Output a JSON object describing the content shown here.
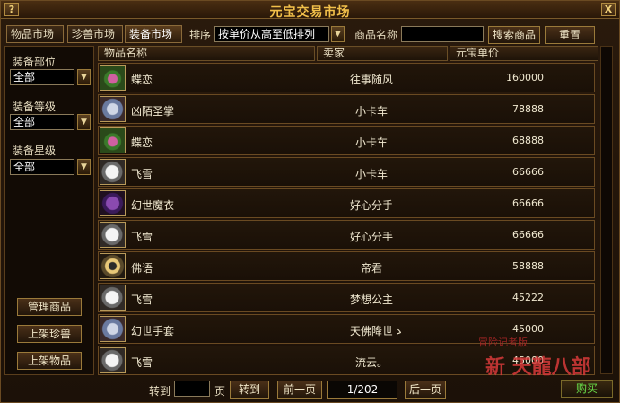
{
  "window": {
    "title": "元宝交易市场",
    "help_label": "?",
    "close_label": "X"
  },
  "tabs": [
    {
      "label": "物品市场"
    },
    {
      "label": "珍兽市场"
    },
    {
      "label": "装备市场"
    }
  ],
  "toolbar": {
    "sort_label": "排序",
    "sort_value": "按单价从高至低排列",
    "name_label": "商品名称",
    "search_button": "搜索商品",
    "reset_button": "重置"
  },
  "sidebar": {
    "slot_label": "装备部位",
    "slot_value": "全部",
    "level_label": "装备等级",
    "level_value": "全部",
    "star_label": "装备星级",
    "star_value": "全部",
    "manage_button": "管理商品",
    "list_pet_button": "上架珍兽",
    "list_item_button": "上架物品"
  },
  "columns": {
    "name": "物品名称",
    "seller": "卖家",
    "price": "元宝单价"
  },
  "rows": [
    {
      "icon": "gem-amulet-icon",
      "name": "蝶恋",
      "seller": "往事随风",
      "price": "160000"
    },
    {
      "icon": "gauntlet-icon",
      "name": "凶陌圣掌",
      "seller": "小卡车",
      "price": "78888"
    },
    {
      "icon": "gem-amulet-icon",
      "name": "蝶恋",
      "seller": "小卡车",
      "price": "68888"
    },
    {
      "icon": "ghost-icon",
      "name": "飞雪",
      "seller": "小卡车",
      "price": "66666"
    },
    {
      "icon": "robe-icon",
      "name": "幻世魔衣",
      "seller": "好心分手",
      "price": "66666"
    },
    {
      "icon": "ghost-icon",
      "name": "飞雪",
      "seller": "好心分手",
      "price": "66666"
    },
    {
      "icon": "ring-icon",
      "name": "佛语",
      "seller": "帝君",
      "price": "58888"
    },
    {
      "icon": "ghost-icon",
      "name": "飞雪",
      "seller": "梦想公主",
      "price": "45222"
    },
    {
      "icon": "gauntlet-icon",
      "name": "幻世手套",
      "seller": "__天佛降世ゝ",
      "price": "45000"
    },
    {
      "icon": "ghost-icon",
      "name": "飞雪",
      "seller": "流云。",
      "price": "45000"
    }
  ],
  "pager": {
    "goto_label": "转到",
    "page_unit": "页",
    "goto_button": "转到",
    "prev_button": "前一页",
    "page_indicator": "1/202",
    "next_button": "后一页"
  },
  "buy_button": "购买",
  "watermark": {
    "small": "冒险记者版",
    "big": "新 天龍八部"
  }
}
